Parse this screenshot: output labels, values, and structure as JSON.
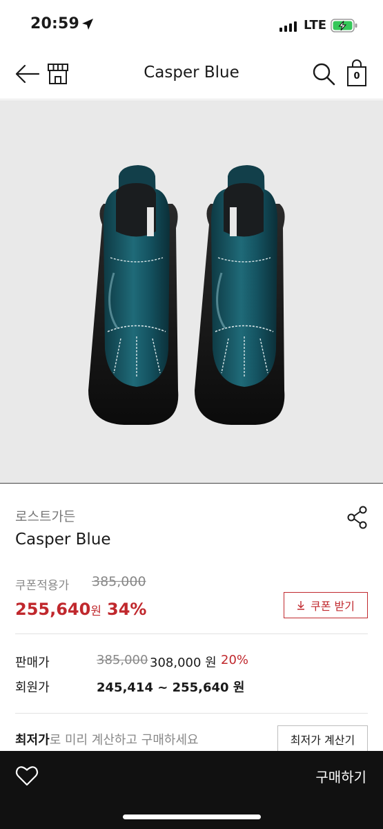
{
  "status_bar": {
    "time": "20:59",
    "network": "LTE"
  },
  "nav": {
    "title": "Casper Blue",
    "cart_count": "0"
  },
  "product": {
    "brand": "로스트가든",
    "name": "Casper Blue",
    "image_alt": "Casper Blue"
  },
  "coupon": {
    "label": "쿠폰적용가",
    "original_price": "385,000",
    "price": "255,640",
    "price_unit": "원",
    "discount": "34%",
    "button_label": "쿠폰 받기"
  },
  "sale": {
    "label": "판매가",
    "original": "385,000",
    "price": "308,000 원",
    "rate": "20%"
  },
  "member": {
    "label": "회원가",
    "price": "245,414 ~ 255,640 원"
  },
  "lowest": {
    "bold_text": "최저가",
    "text": "로 미리 계산하고 구매하세요",
    "button_label": "최저가 계산기"
  },
  "bottom": {
    "buy_label": "구매하기"
  },
  "colors": {
    "accent": "#c0282d",
    "bottom_bar": "#111111",
    "image_bg": "#e9e9e9"
  }
}
